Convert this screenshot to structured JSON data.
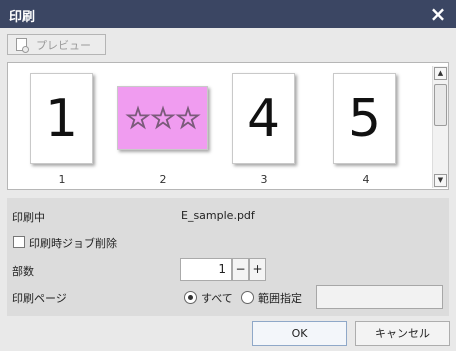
{
  "window": {
    "title": "印刷",
    "close_icon": "×"
  },
  "toolbar": {
    "preview_label": "プレビュー"
  },
  "preview": {
    "pages": [
      {
        "content": "1",
        "label": "1",
        "style": "number"
      },
      {
        "content": "☆☆☆",
        "label": "2",
        "style": "stars",
        "color": "#f09cf0"
      },
      {
        "content": "4",
        "label": "3",
        "style": "number"
      },
      {
        "content": "5",
        "label": "4",
        "style": "number"
      }
    ],
    "scroll_up_icon": "▲",
    "scroll_down_icon": "▼"
  },
  "settings": {
    "printing_label": "印刷中",
    "printing_file": "E_sample.pdf",
    "delete_job_label": "印刷時ジョブ削除",
    "delete_job_checked": false,
    "copies_label": "部数",
    "copies_value": "1",
    "minus_label": "−",
    "plus_label": "+",
    "pages_label": "印刷ページ",
    "all_label": "すべて",
    "range_label": "範囲指定",
    "selected_option": "all",
    "range_value": ""
  },
  "buttons": {
    "ok_label": "OK",
    "cancel_label": "キャンセル"
  },
  "colors": {
    "titlebar": "#3b4663",
    "page2_fill": "#f09cf0",
    "panel_bg": "#dcdcdc"
  }
}
